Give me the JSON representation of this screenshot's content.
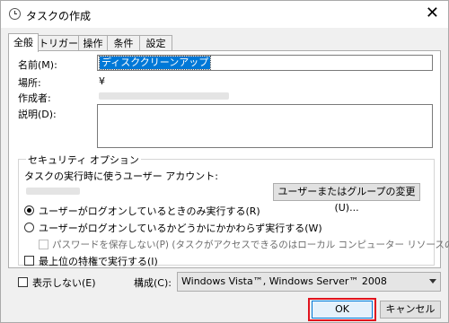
{
  "window": {
    "title": "タスクの作成",
    "close_glyph": "✕",
    "icon": "clock-icon"
  },
  "tabs": [
    {
      "label": "全般"
    },
    {
      "label": "トリガー"
    },
    {
      "label": "操作"
    },
    {
      "label": "条件"
    },
    {
      "label": "設定"
    }
  ],
  "general": {
    "name_label": "名前(M):",
    "name_value": "ディスククリーンアップ",
    "location_label": "場所:",
    "location_value": "¥",
    "author_label": "作成者:",
    "description_label": "説明(D):"
  },
  "security": {
    "group_title": "セキュリティ オプション",
    "account_prompt": "タスクの実行時に使うユーザー アカウント:",
    "change_user_button": "ユーザーまたはグループの変更(U)...",
    "radio_logged_on": "ユーザーがログオンしているときのみ実行する(R)",
    "radio_whether": "ユーザーがログオンしているかどうかにかかわらず実行する(W)",
    "no_store_password": "パスワードを保存しない(P) (タスクがアクセスできるのはローカル コンピューター リソースのみ)",
    "highest_privileges": "最上位の特権で実行する(I)"
  },
  "footer": {
    "hidden_label": "表示しない(E)",
    "configure_label": "構成(C):",
    "configure_value": "Windows Vista™, Windows Server™ 2008",
    "ok_label": "OK",
    "cancel_label": "キャンセル"
  },
  "colors": {
    "selection": "#0078d7",
    "highlight_border": "#e0141e"
  }
}
